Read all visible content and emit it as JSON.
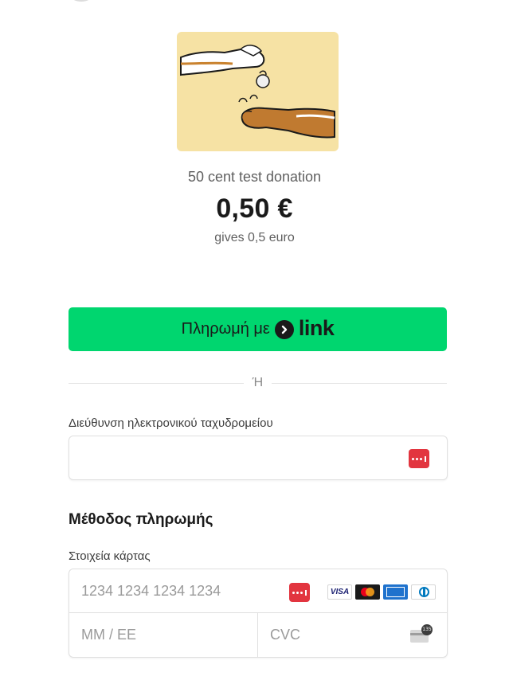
{
  "product": {
    "name": "50 cent test donation",
    "price": "0,50 €",
    "description": "gives 0,5 euro"
  },
  "link_button": {
    "label": "Πληρωμή με",
    "logo_text": "link"
  },
  "divider": {
    "text": "Ή"
  },
  "email": {
    "label": "Διεύθυνση ηλεκτρονικού ταχυδρομείου",
    "value": "",
    "placeholder": ""
  },
  "payment_method": {
    "title": "Μέθοδος πληρωμής",
    "card_label": "Στοιχεία κάρτας",
    "card_number_placeholder": "1234 1234 1234 1234",
    "expiry_placeholder": "MM / ΕΕ",
    "cvc_placeholder": "CVC",
    "card_brands": [
      {
        "name": "visa-icon",
        "text": "VISA"
      },
      {
        "name": "mastercard-icon"
      },
      {
        "name": "amex-icon"
      },
      {
        "name": "diners-icon"
      }
    ],
    "cvc_badge": "135"
  },
  "colors": {
    "link_green": "#00d66f",
    "product_bg": "#f6e2a4",
    "password_manager_red": "#e2353f"
  }
}
